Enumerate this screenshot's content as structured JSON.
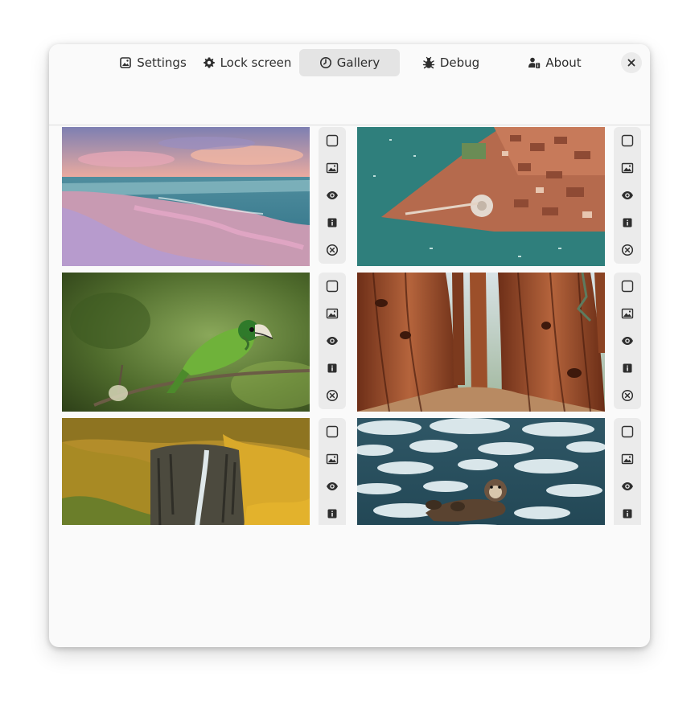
{
  "tabs": [
    {
      "label": "Settings",
      "icon": "image-icon"
    },
    {
      "label": "Lock screen",
      "icon": "gear-icon"
    },
    {
      "label": "Gallery",
      "icon": "clock-icon",
      "active": true
    },
    {
      "label": "Debug",
      "icon": "bug-icon"
    },
    {
      "label": "About",
      "icon": "person-info-icon"
    }
  ],
  "gallery": {
    "image_actions": [
      "select-checkbox",
      "set-wallpaper",
      "preview",
      "info",
      "remove"
    ],
    "items": [
      {
        "subject": "pastel beach at sunset"
      },
      {
        "subject": "aerial view of Venice"
      },
      {
        "subject": "green toucanet on branch"
      },
      {
        "subject": "giant sequoia trees"
      },
      {
        "subject": "waterfall in golden hills"
      },
      {
        "subject": "sea otter among ice floes"
      }
    ]
  },
  "colors": {
    "window_bg": "#fafafa",
    "active_tab_bg": "#e4e4e4",
    "button_bg": "#ebebeb",
    "text": "#2e2e2e"
  }
}
